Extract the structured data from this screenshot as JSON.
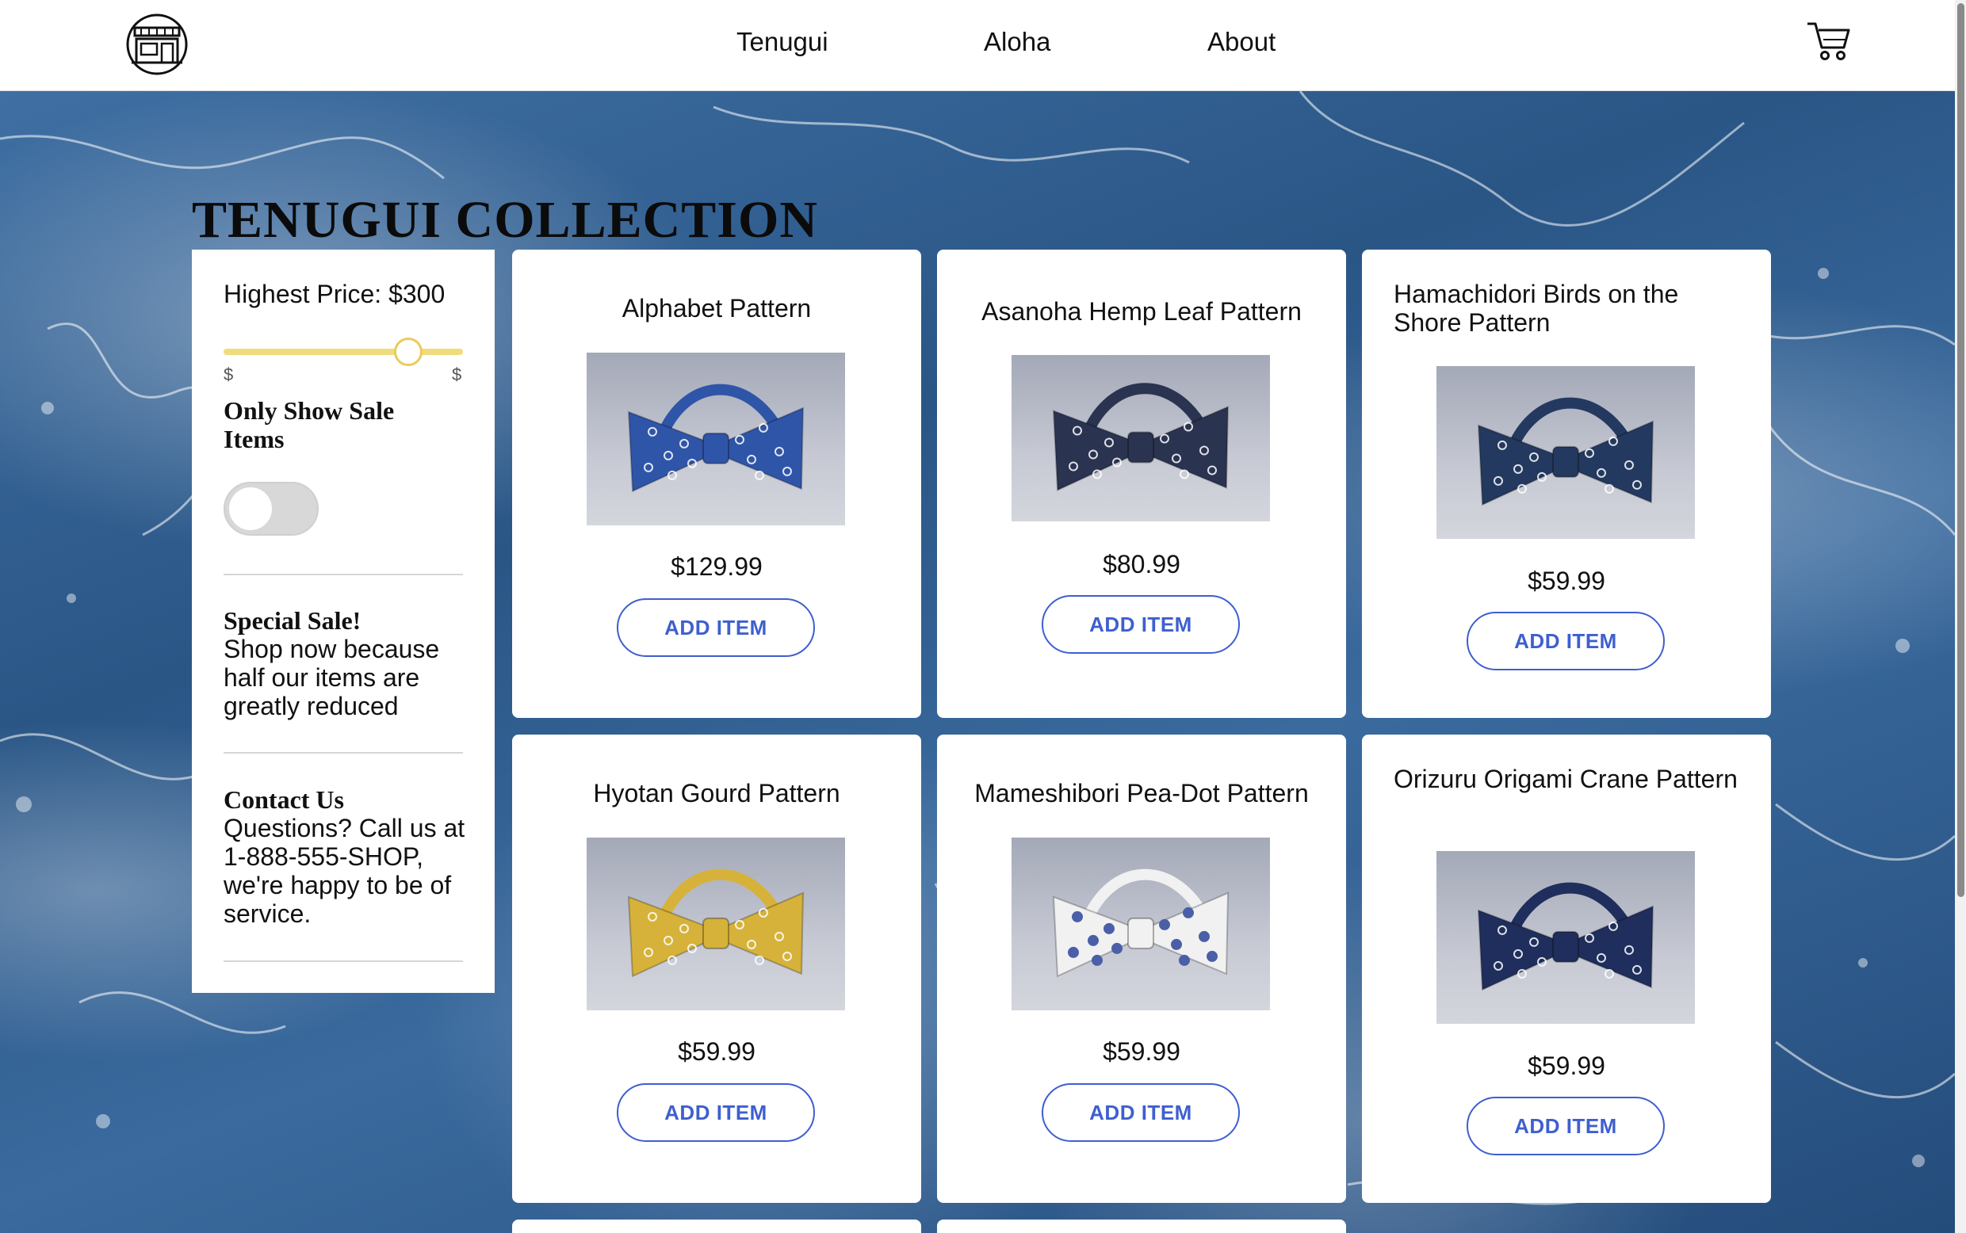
{
  "header": {
    "logo_icon": "shop-storefront-icon",
    "nav": [
      {
        "label": "Tenugui"
      },
      {
        "label": "Aloha"
      },
      {
        "label": "About"
      }
    ],
    "cart_icon": "shopping-cart-icon"
  },
  "page": {
    "title": "TENUGUI COLLECTION"
  },
  "sidebar": {
    "price_label": "Highest Price: $300",
    "slider": {
      "min_label": "$",
      "max_label": "$",
      "value_fraction": 0.77,
      "color": "#f1dc7d"
    },
    "sale_toggle_label": "Only Show Sale Items",
    "sale_toggle_on": false,
    "special_sale_title": "Special Sale!",
    "special_sale_text": "Shop now because half our items are greatly reduced",
    "contact_title": "Contact Us",
    "contact_text": "Questions? Call us at 1-888-555-SHOP, we're happy to be of service."
  },
  "products": [
    {
      "name": "Alphabet Pattern",
      "price": "$129.99",
      "button": "ADD ITEM",
      "fabric_color": "#2f55a8",
      "pattern": "letters"
    },
    {
      "name": "Asanoha Hemp Leaf Pattern",
      "price": "$80.99",
      "button": "ADD ITEM",
      "fabric_color": "#2a3350",
      "pattern": "star"
    },
    {
      "name": "Hamachidori Birds on the Shore Pattern",
      "price": "$59.99",
      "button": "ADD ITEM",
      "fabric_color": "#24395f",
      "pattern": "birds"
    },
    {
      "name": "Hyotan Gourd Pattern",
      "price": "$59.99",
      "button": "ADD ITEM",
      "fabric_color": "#d6b23a",
      "pattern": "gourd"
    },
    {
      "name": "Mameshibori Pea-Dot Pattern",
      "price": "$59.99",
      "button": "ADD ITEM",
      "fabric_color": "#f1f1f1",
      "pattern": "dots"
    },
    {
      "name": "Orizuru Origami Crane Pattern",
      "price": "$59.99",
      "button": "ADD ITEM",
      "fabric_color": "#1f2e5c",
      "pattern": "crane"
    }
  ],
  "colors": {
    "accent_button": "#3e5fcf",
    "header_bg": "#ffffff",
    "ocean": "#2c5b8c"
  }
}
